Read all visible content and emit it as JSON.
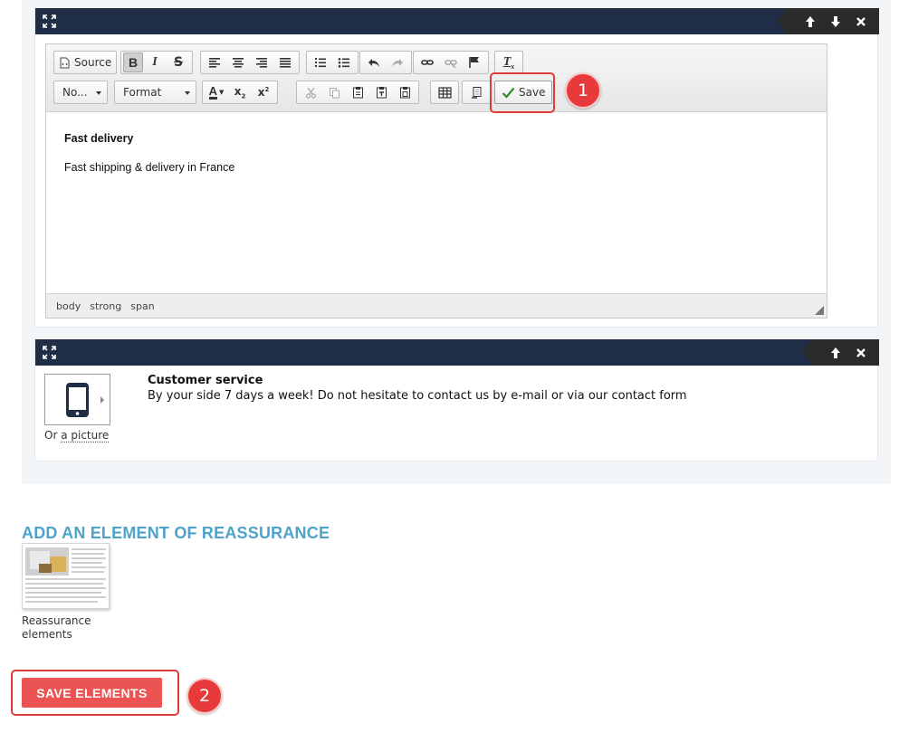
{
  "editor_block": {
    "toolbar": {
      "source_label": "Source",
      "normal_combo": "No...",
      "format_combo": "Format",
      "save_label": "Save"
    },
    "content": {
      "heading": "Fast delivery",
      "text": "Fast shipping & delivery in France"
    },
    "path": [
      "body",
      "strong",
      "span"
    ]
  },
  "service_block": {
    "title": "Customer service",
    "description": "By your side 7 days a week! Do not hesitate to contact us by e-mail or via our contact form",
    "or_text": "Or",
    "picture_link": "a picture"
  },
  "add_section": {
    "title": "ADD AN ELEMENT OF REASSURANCE",
    "thumb_label": "Reassurance elements"
  },
  "save_elements_label": "SAVE ELEMENTS",
  "annotations": {
    "one": "1",
    "two": "2"
  },
  "colors": {
    "header": "#1f2d47",
    "accent_blue": "#4da3c9",
    "save_red": "#ec5454",
    "annotation_red": "#e03b3b",
    "save_check": "#2e8b2e"
  }
}
